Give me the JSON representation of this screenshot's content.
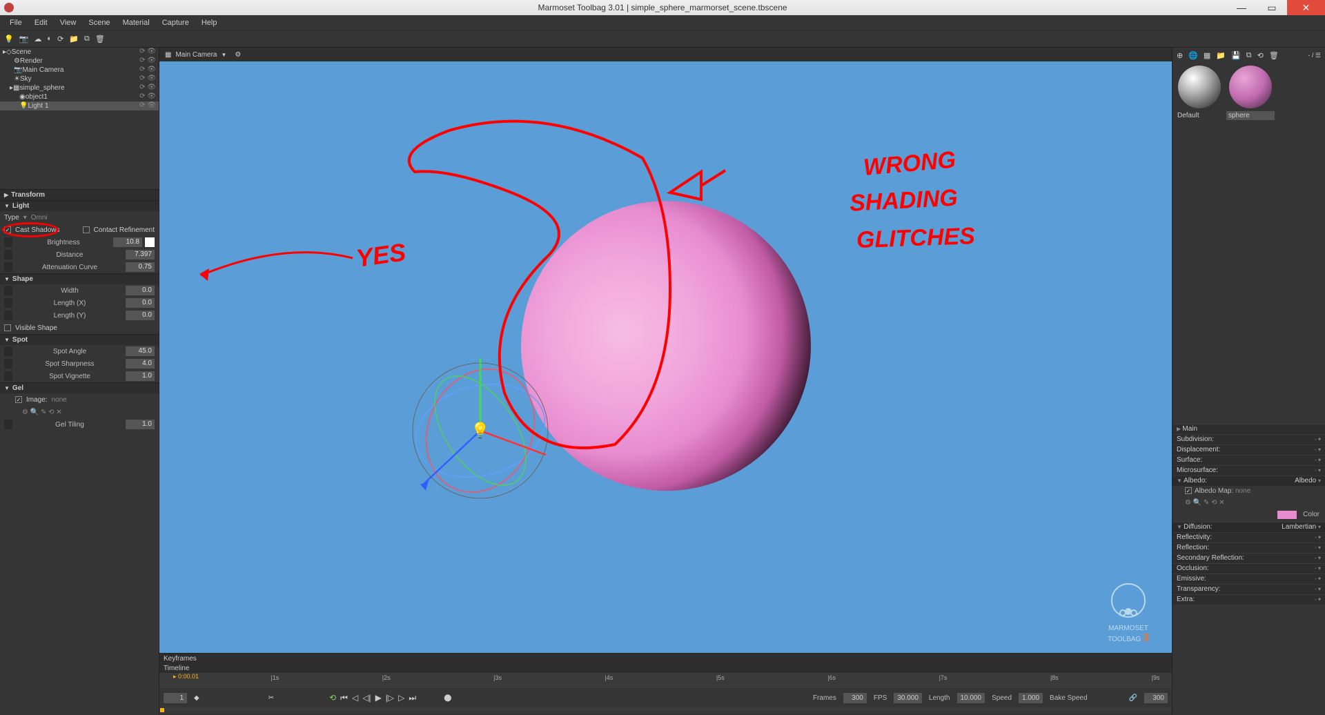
{
  "app_title": "Marmoset Toolbag 3.01  |  simple_sphere_marmorset_scene.tbscene",
  "menus": [
    "File",
    "Edit",
    "View",
    "Scene",
    "Material",
    "Capture",
    "Help"
  ],
  "outliner": {
    "root": "Scene",
    "items": [
      {
        "name": "Render",
        "indent": 1,
        "icon": "gear"
      },
      {
        "name": "Main Camera",
        "indent": 1,
        "icon": "camera"
      },
      {
        "name": "Sky",
        "indent": 1,
        "icon": "sky"
      },
      {
        "name": "simple_sphere",
        "indent": 1,
        "icon": "mesh"
      },
      {
        "name": "object1",
        "indent": 2,
        "icon": "cube"
      },
      {
        "name": "Light 1",
        "indent": 2,
        "icon": "light",
        "selected": true
      }
    ]
  },
  "inspector": {
    "transform_header": "Transform",
    "light_header": "Light",
    "type_label": "Type",
    "type_value": "Omni",
    "cast_shadows": "Cast Shadows",
    "cast_shadows_on": true,
    "contact_refinement": "Contact Refinement",
    "contact_refinement_on": false,
    "brightness": {
      "label": "Brightness",
      "value": "10.8"
    },
    "distance": {
      "label": "Distance",
      "value": "7.397"
    },
    "attenuation": {
      "label": "Attenuation Curve",
      "value": "0.75"
    },
    "shape_header": "Shape",
    "width": {
      "label": "Width",
      "value": "0.0"
    },
    "length_x": {
      "label": "Length (X)",
      "value": "0.0"
    },
    "length_y": {
      "label": "Length (Y)",
      "value": "0.0"
    },
    "visible_shape": "Visible Shape",
    "spot_header": "Spot",
    "spot_angle": {
      "label": "Spot Angle",
      "value": "45.0"
    },
    "spot_sharpness": {
      "label": "Spot Sharpness",
      "value": "4.0"
    },
    "spot_vignette": {
      "label": "Spot Vignette",
      "value": "1.0"
    },
    "gel_header": "Gel",
    "gel_image": "Image: ",
    "gel_image_val": "none",
    "gel_tiling": {
      "label": "Gel Tiling",
      "value": "1.0"
    }
  },
  "viewport": {
    "tab": "Main Camera",
    "annotations": {
      "yes": "YES",
      "wrong_lines": [
        "WRONG",
        "SHADING",
        "GLITCHES"
      ]
    },
    "logo_line1": "MARMOSET",
    "logo_line2": "TOOLBAG"
  },
  "timeline": {
    "keyframes": "Keyframes",
    "timeline": "Timeline",
    "ticks": [
      "|1s",
      "|2s",
      "|3s",
      "|4s",
      "|5s",
      "|6s",
      "|7s",
      "|8s",
      "|9s"
    ],
    "cursor": "0:00.01",
    "frame_field": "1",
    "frames_label": "Frames",
    "frames_val": "300",
    "fps_label": "FPS",
    "fps_val": "30.000",
    "length_label": "Length",
    "length_val": "10.000",
    "speed_label": "Speed",
    "speed_val": "1.000",
    "bake_speed": "Bake Speed",
    "end_val": "300"
  },
  "materials": {
    "default": "Default",
    "sphere": "sphere",
    "sections": {
      "main": "Main",
      "subdivision": "Subdivision:",
      "displacement": "Displacement:",
      "surface": "Surface:",
      "microsurface": "Microsurface:",
      "albedo": "Albedo:",
      "albedo_mode": "Albedo",
      "albedo_map_label": "Albedo Map: ",
      "albedo_map_val": "none",
      "color_label": "Color",
      "diffusion": "Diffusion:",
      "diffusion_mode": "Lambertian",
      "reflectivity": "Reflectivity:",
      "reflection": "Reflection:",
      "secondary_reflection": "Secondary Reflection:",
      "occlusion": "Occlusion:",
      "emissive": "Emissive:",
      "transparency": "Transparency:",
      "extra": "Extra:"
    }
  }
}
